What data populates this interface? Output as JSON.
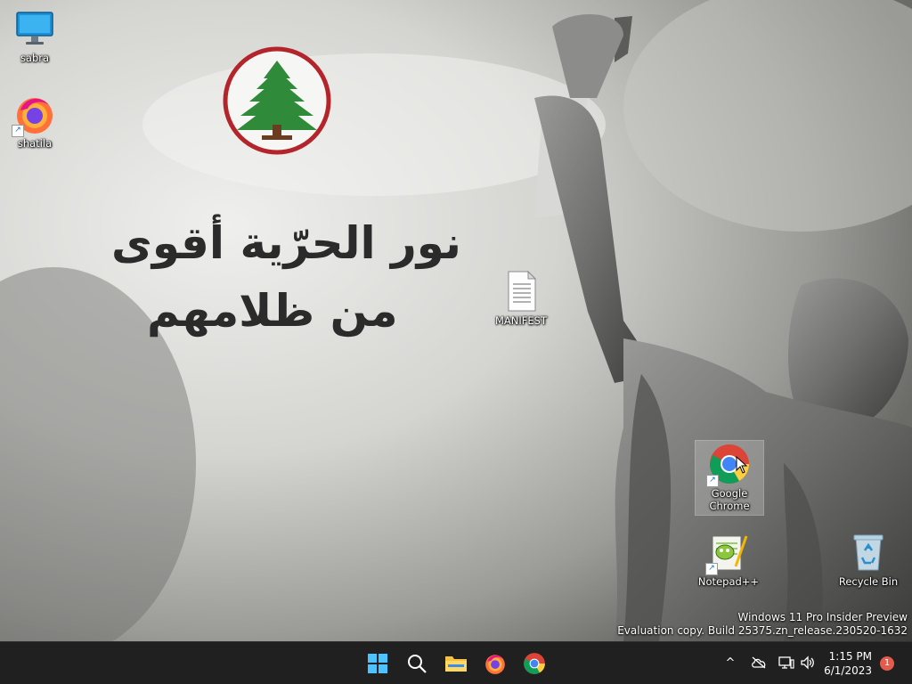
{
  "wallpaper": {
    "arabic_line_1": "نور الحرّية أقوى",
    "arabic_line_2": "من ظلامهم",
    "logo": "lebanese-forces-cedar-logo"
  },
  "desktop_icons": [
    {
      "label": "sabra",
      "icon": "monitor-icon"
    },
    {
      "label": "shatila",
      "icon": "firefox-icon"
    },
    {
      "label": "MANIFEST",
      "icon": "text-document-icon"
    },
    {
      "label": "Google Chrome",
      "icon": "chrome-icon"
    },
    {
      "label": "Notepad++",
      "icon": "notepadpp-icon"
    },
    {
      "label": "Recycle Bin",
      "icon": "recycle-bin-icon"
    }
  ],
  "watermark": {
    "line1": "Windows 11 Pro Insider Preview",
    "line2": "Evaluation copy. Build 25375.zn_release.230520-1632"
  },
  "taskbar": {
    "apps": [
      "start-icon",
      "search-icon",
      "file-explorer-icon",
      "firefox-icon",
      "chrome-icon"
    ],
    "tray": {
      "chevron": "^",
      "time": "1:15 PM",
      "date": "6/1/2023",
      "notification_count": "1"
    }
  },
  "colors": {
    "taskbar_bg": "#202020",
    "badge": "#e45b4b",
    "logo_ring": "#b3242b",
    "cedar_green": "#2f8a3a"
  }
}
